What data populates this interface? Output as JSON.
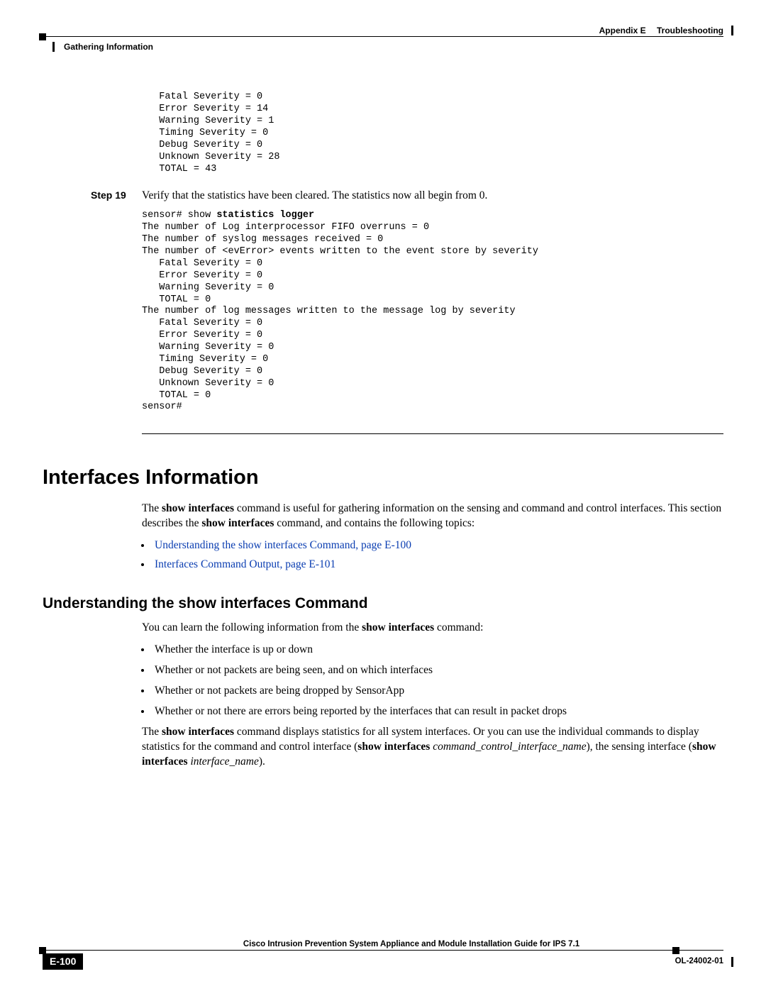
{
  "header": {
    "appendix": "Appendix E",
    "title": "Troubleshooting",
    "section": "Gathering Information"
  },
  "code_block_1": "   Fatal Severity = 0\n   Error Severity = 14\n   Warning Severity = 1\n   Timing Severity = 0\n   Debug Severity = 0\n   Unknown Severity = 28\n   TOTAL = 43",
  "step": {
    "label": "Step 19",
    "text": "Verify that the statistics have been cleared. The statistics now all begin from 0."
  },
  "code_block_2_prefix": "sensor# show ",
  "code_block_2_bold": "statistics logger",
  "code_block_2_body": "\nThe number of Log interprocessor FIFO overruns = 0\nThe number of syslog messages received = 0\nThe number of <evError> events written to the event store by severity\n   Fatal Severity = 0\n   Error Severity = 0\n   Warning Severity = 0\n   TOTAL = 0\nThe number of log messages written to the message log by severity\n   Fatal Severity = 0\n   Error Severity = 0\n   Warning Severity = 0\n   Timing Severity = 0\n   Debug Severity = 0\n   Unknown Severity = 0\n   TOTAL = 0\nsensor#",
  "h1": "Interfaces Information",
  "intro_prefix": "The ",
  "intro_bold1": "show interfaces",
  "intro_mid": " command is useful for gathering information on the sensing and command and control interfaces. This section describes the ",
  "intro_bold2": "show interfaces",
  "intro_suffix": " command, and contains the following topics:",
  "links": [
    "Understanding the show interfaces Command, page E-100",
    "Interfaces Command Output, page E-101"
  ],
  "h2": "Understanding the show interfaces Command",
  "learn_prefix": "You can learn the following information from the ",
  "learn_bold": "show interfaces",
  "learn_suffix": " command:",
  "bullets": [
    "Whether the interface is up or down",
    "Whether or not packets are being seen, and on which interfaces",
    "Whether or not packets are being dropped by SensorApp",
    "Whether or not there are errors being reported by the interfaces that can result in packet drops"
  ],
  "closing_prefix": "The ",
  "closing_bold1": "show interfaces",
  "closing_mid1": " command displays statistics for all system interfaces. Or you can use the individual commands to display statistics for the command and control interface (",
  "closing_bold2": "show interfaces",
  "closing_ital1": " command_control_interface_name",
  "closing_mid2": "), the sensing interface (",
  "closing_bold3": "show interfaces",
  "closing_ital2": " interface_name",
  "closing_suffix": ").",
  "footer": {
    "guide": "Cisco Intrusion Prevention System Appliance and Module Installation Guide for IPS 7.1",
    "page": "E-100",
    "docid": "OL-24002-01"
  }
}
